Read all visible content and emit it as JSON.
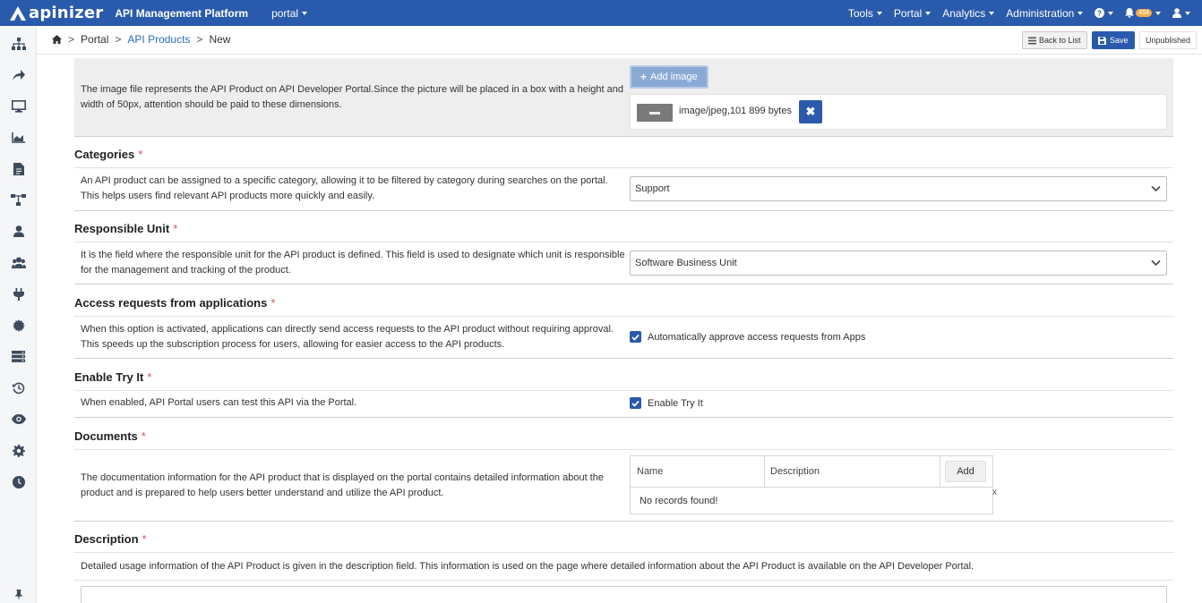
{
  "header": {
    "logo_text": "apinizer",
    "platform_title": "API Management Platform",
    "project_selector": "portal",
    "menu": [
      "Tools",
      "Portal",
      "Analytics",
      "Administration"
    ],
    "notification_badge": "454",
    "brand_color": "#2a5aab"
  },
  "sidebar": {
    "icons": [
      "sitemap-icon",
      "share-icon",
      "monitor-icon",
      "area-chart-icon",
      "document-icon",
      "flow-icon",
      "user-icon",
      "users-icon",
      "plug-icon",
      "gear-badge-icon",
      "server-icon",
      "history-icon",
      "eye-icon",
      "settings-icon",
      "clock-icon",
      "pin-icon"
    ]
  },
  "breadcrumb": {
    "home_icon": "home-icon",
    "items": [
      "Portal",
      "API Products",
      "New"
    ]
  },
  "actions": {
    "back": "Back to List",
    "save": "Save",
    "status": "Unpublished"
  },
  "image_section": {
    "description": "The image file represents the API Product on API Developer Portal.Since the picture will be placed in a box with a height and width of 50px, attention should be paid to these dimensions.",
    "add_button": "Add image",
    "file_info": "image/jpeg,101 899 bytes"
  },
  "categories": {
    "title": "Categories",
    "description": "An API product can be assigned to a specific category, allowing it to be filtered by category during searches on the portal. This helps users find relevant API products more quickly and easily.",
    "selected": "Support"
  },
  "responsible_unit": {
    "title": "Responsible Unit",
    "description": "It is the field where the responsible unit for the API product is defined. This field is used to designate which unit is responsible for the management and tracking of the product.",
    "selected": "Software Business Unit"
  },
  "access_requests": {
    "title": "Access requests from applications",
    "description": "When this option is activated, applications can directly send access requests to the API product without requiring approval. This speeds up the subscription process for users, allowing for easier access to the API products.",
    "checkbox_label": "Automatically approve access requests from Apps",
    "checked": true
  },
  "try_it": {
    "title": "Enable Try It",
    "description": "When enabled, API Portal users can test this API via the Portal.",
    "checkbox_label": "Enable Try It",
    "checked": true
  },
  "documents": {
    "title": "Documents",
    "description": "The documentation information for the API product that is displayed on the portal contains detailed information about the product and is prepared to help users better understand and utilize the API product.",
    "columns": [
      "Name",
      "Description"
    ],
    "add_button": "Add",
    "empty_text": "No records found!",
    "close_mark": "x"
  },
  "description_section": {
    "title": "Description",
    "description": "Detailed usage information of the API Product is given in the description field. This information is used on the page where detailed information about the API Product is available on the API Developer Portal."
  },
  "required_mark": "*"
}
